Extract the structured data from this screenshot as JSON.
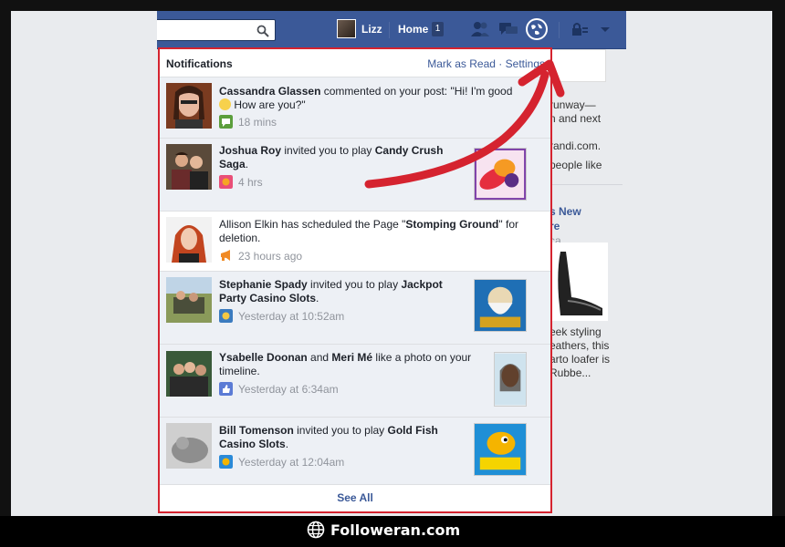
{
  "header": {
    "user_name": "Lizz",
    "home_label": "Home",
    "home_badge": "1"
  },
  "notifications": {
    "title": "Notifications",
    "mark_as_read": "Mark as Read",
    "separator": "·",
    "settings": "Settings",
    "see_all": "See All",
    "items": [
      {
        "actor": "Cassandra Glassen",
        "text_a": " commented on your post: \"Hi! I'm good",
        "text_b": " How are you?\"",
        "time": "18 mins"
      },
      {
        "actor": "Joshua Roy",
        "text_a": " invited you to play ",
        "target": "Candy Crush",
        "target_b": "Saga",
        "text_b": ".",
        "time": "4 hrs"
      },
      {
        "actor": "Allison Elkin",
        "text_a": " has scheduled the Page \"",
        "target": "Stomping Ground",
        "text_b": "\" for",
        "text_c": "deletion.",
        "time": "23 hours ago"
      },
      {
        "actor": "Stephanie Spady",
        "text_a": " invited you to play ",
        "target": "Jackpot",
        "target_b": "Party Casino Slots",
        "text_b": ".",
        "time": "Yesterday at 10:52am"
      },
      {
        "actor": "Ysabelle Doonan",
        "text_a": " and ",
        "actor_b": "Meri Mé",
        "text_b": " like a photo on your",
        "text_c": "timeline.",
        "time": "Yesterday at 6:34am"
      },
      {
        "actor": "Bill Tomenson",
        "text_a": " invited you to play ",
        "target": "Gold Fish",
        "target_b": "Casino Slots",
        "text_b": ".",
        "time": "Yesterday at 12:04am"
      }
    ]
  },
  "sidebar_right": {
    "lines": [
      "runway—",
      "n and next",
      "randi.com.",
      "people like",
      "s New",
      "re",
      "ca",
      "eek styling",
      "eathers, this",
      "arto loafer is",
      "Rubbe..."
    ]
  },
  "watermark": "Followeran.com",
  "colors": {
    "brand_blue": "#3b5998",
    "highlight_red": "#d5232f",
    "unread_bg": "#edf0f5"
  }
}
